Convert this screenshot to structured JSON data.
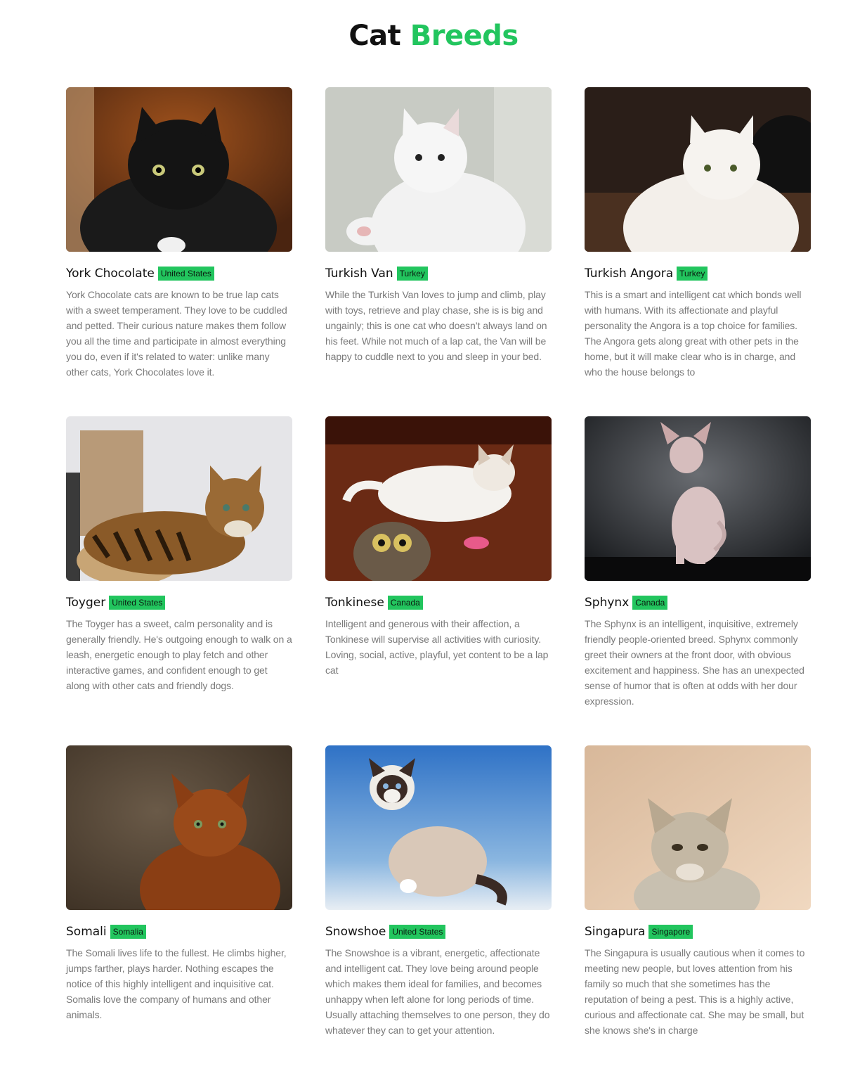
{
  "page": {
    "title_part1": "Cat",
    "title_part2": "Breeds"
  },
  "colors": {
    "accent": "#22c55e"
  },
  "cards": [
    {
      "name": "York Chocolate",
      "origin": "United States",
      "description": "York Chocolate cats are known to be true lap cats with a sweet temperament. They love to be cuddled and petted. Their curious nature makes them follow you all the time and participate in almost everything you do, even if it's related to water: unlike many other cats, York Chocolates love it."
    },
    {
      "name": "Turkish Van",
      "origin": "Turkey",
      "description": "While the Turkish Van loves to jump and climb, play with toys, retrieve and play chase, she is is big and ungainly; this is one cat who doesn’t always land on his feet. While not much of a lap cat, the Van will be happy to cuddle next to you and sleep in your bed."
    },
    {
      "name": "Turkish Angora",
      "origin": "Turkey",
      "description": "This is a smart and intelligent cat which bonds well with humans. With its affectionate and playful personality the Angora is a top choice for families. The Angora gets along great with other pets in the home, but it will make clear who is in charge, and who the house belongs to"
    },
    {
      "name": "Toyger",
      "origin": "United States",
      "description": "The Toyger has a sweet, calm personality and is generally friendly. He's outgoing enough to walk on a leash, energetic enough to play fetch and other interactive games, and confident enough to get along with other cats and friendly dogs."
    },
    {
      "name": "Tonkinese",
      "origin": "Canada",
      "description": "Intelligent and generous with their affection, a Tonkinese will supervise all activities with curiosity. Loving, social, active, playful, yet content to be a lap cat"
    },
    {
      "name": "Sphynx",
      "origin": "Canada",
      "description": "The Sphynx is an intelligent, inquisitive, extremely friendly people-oriented breed. Sphynx commonly greet their owners at the front door, with obvious excitement and happiness. She has an unexpected sense of humor that is often at odds with her dour expression."
    },
    {
      "name": "Somali",
      "origin": "Somalia",
      "description": "The Somali lives life to the fullest. He climbs higher, jumps farther, plays harder. Nothing escapes the notice of this highly intelligent and inquisitive cat. Somalis love the company of humans and other animals."
    },
    {
      "name": "Snowshoe",
      "origin": "United States",
      "description": "The Snowshoe is a vibrant, energetic, affectionate and intelligent cat. They love being around people which makes them ideal for families, and becomes unhappy when left alone for long periods of time. Usually attaching themselves to one person, they do whatever they can to get your attention."
    },
    {
      "name": "Singapura",
      "origin": "Singapore",
      "description": "The Singapura is usually cautious when it comes to meeting new people, but loves attention from his family so much that she sometimes has the reputation of being a pest. This is a highly active, curious and affectionate cat. She may be small, but she knows she's in charge"
    }
  ]
}
